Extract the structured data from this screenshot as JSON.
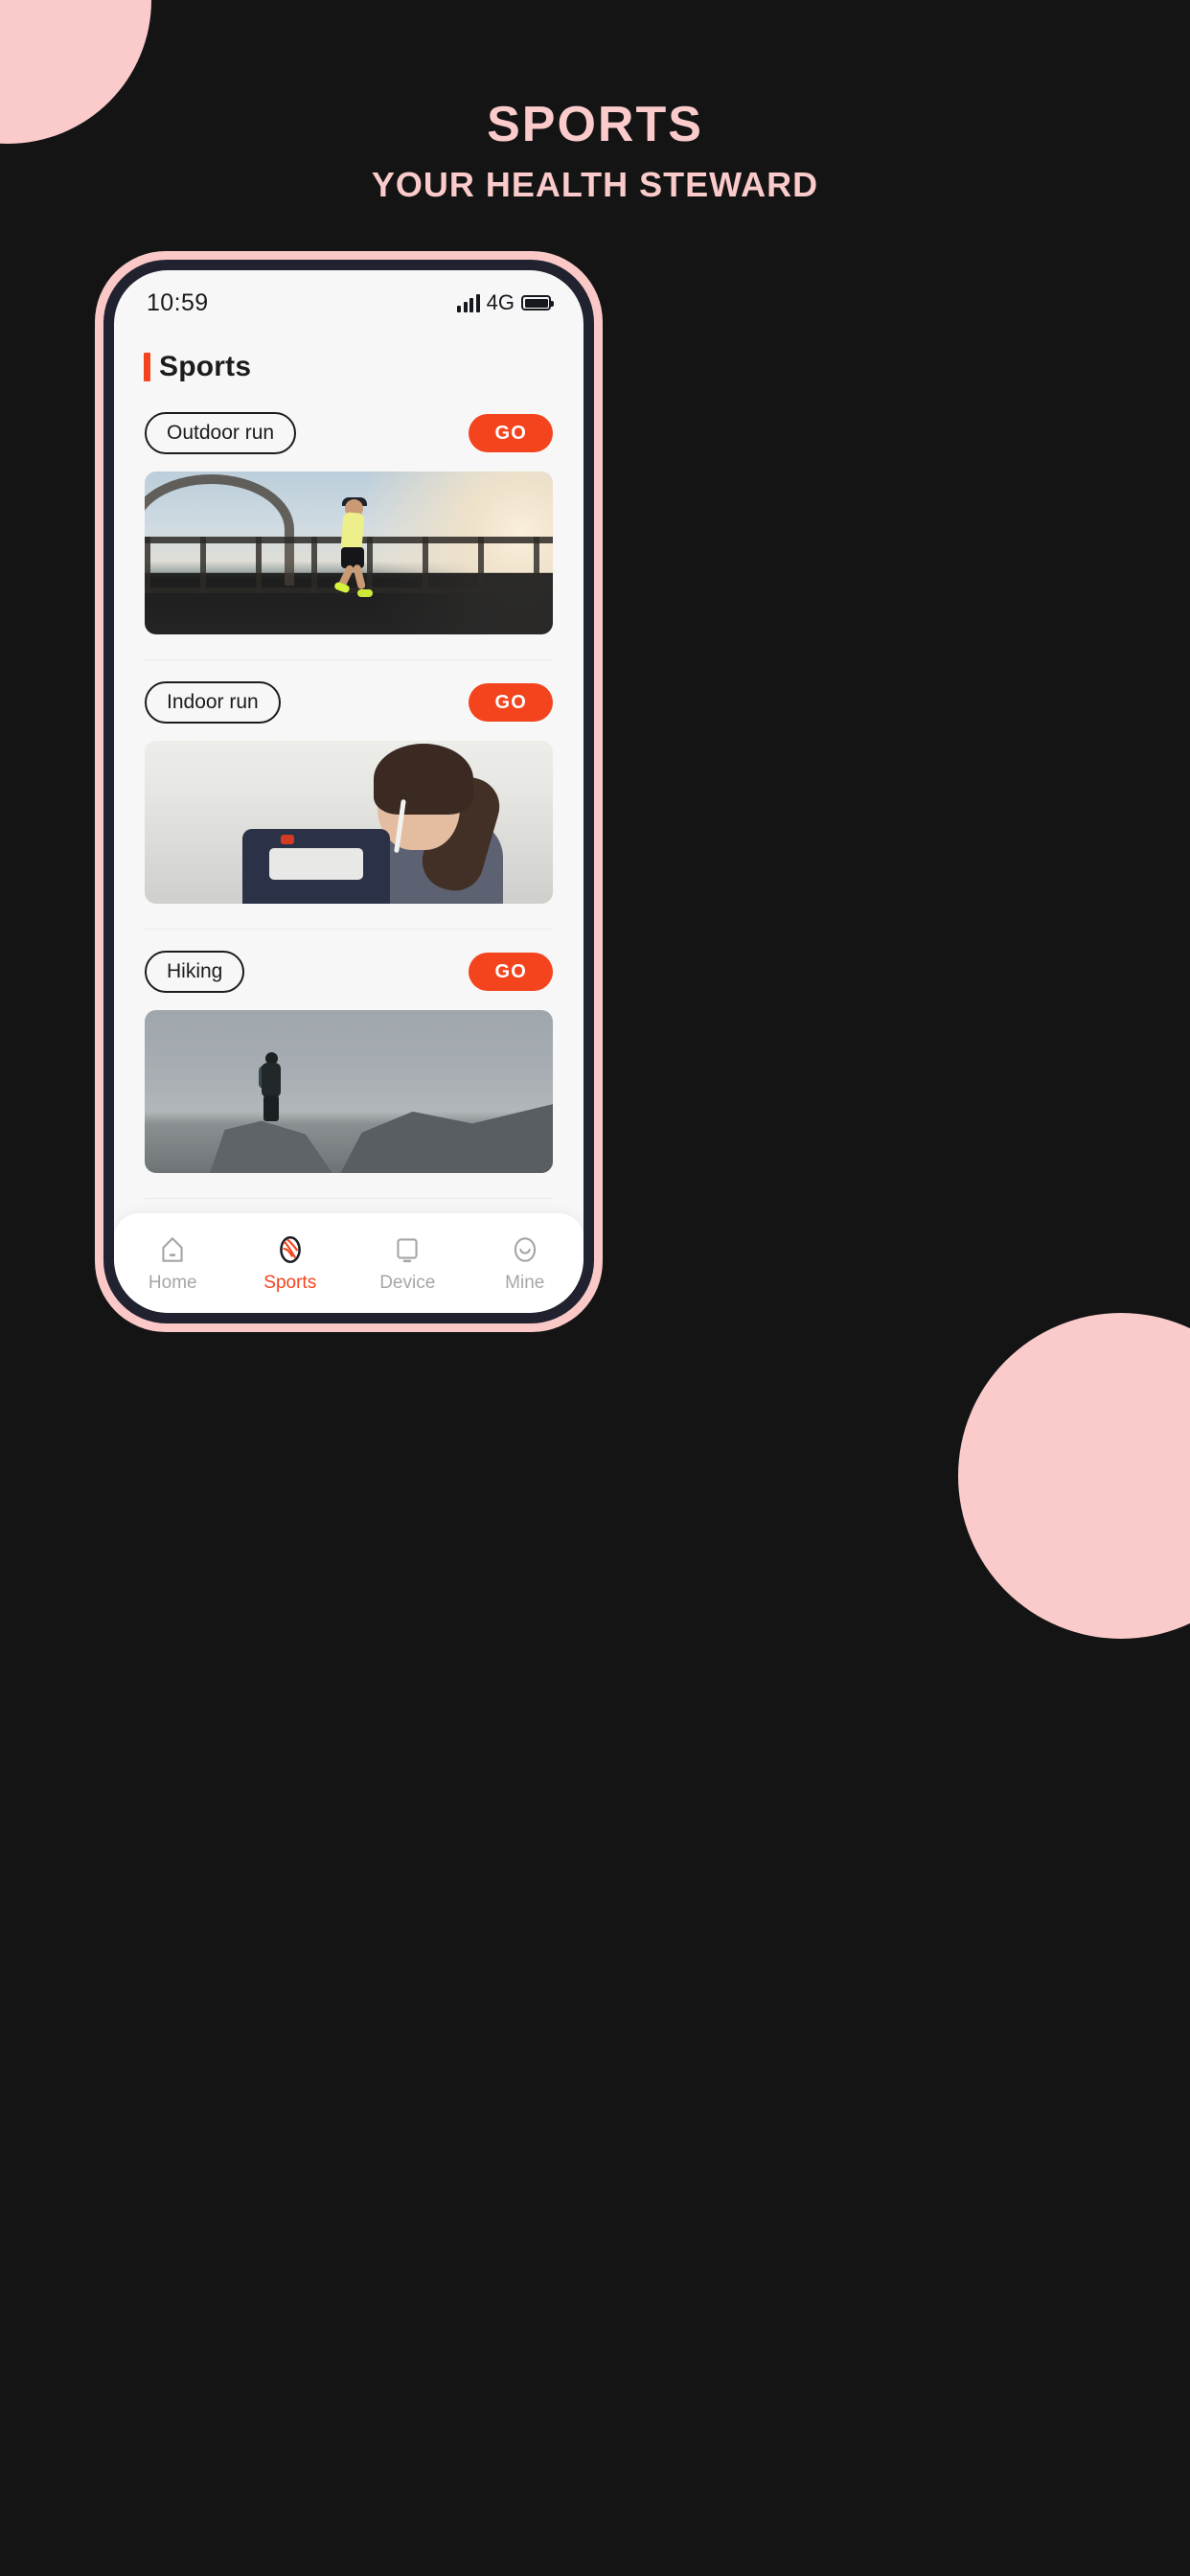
{
  "poster": {
    "title": "SPORTS",
    "subtitle": "YOUR HEALTH STEWARD",
    "bg_color": "#141414",
    "accent_pink": "#FBCBCB"
  },
  "phone": {
    "frame_color": "#FBC8C8",
    "bezel_color": "#20232F",
    "screen_bg": "#F7F7F7"
  },
  "status_bar": {
    "time": "10:59",
    "network": "4G",
    "signal_icon": "signal-bars-icon",
    "battery_icon": "battery-icon"
  },
  "app": {
    "title": "Sports",
    "accent_color": "#F4441E"
  },
  "sports": [
    {
      "label": "Outdoor run",
      "action_label": "GO",
      "image_name": "runner-on-bridge-photo"
    },
    {
      "label": "Indoor run",
      "action_label": "GO",
      "image_name": "woman-on-treadmill-photo"
    },
    {
      "label": "Hiking",
      "action_label": "GO",
      "image_name": "hiker-on-cliff-photo"
    }
  ],
  "bottom_nav": {
    "items": [
      {
        "label": "Home",
        "icon": "home-icon",
        "active": false
      },
      {
        "label": "Sports",
        "icon": "sports-ball-icon",
        "active": true
      },
      {
        "label": "Device",
        "icon": "device-monitor-icon",
        "active": false
      },
      {
        "label": "Mine",
        "icon": "user-smile-icon",
        "active": false
      }
    ],
    "active_color": "#F4441E",
    "inactive_color": "#A6A6A6"
  }
}
